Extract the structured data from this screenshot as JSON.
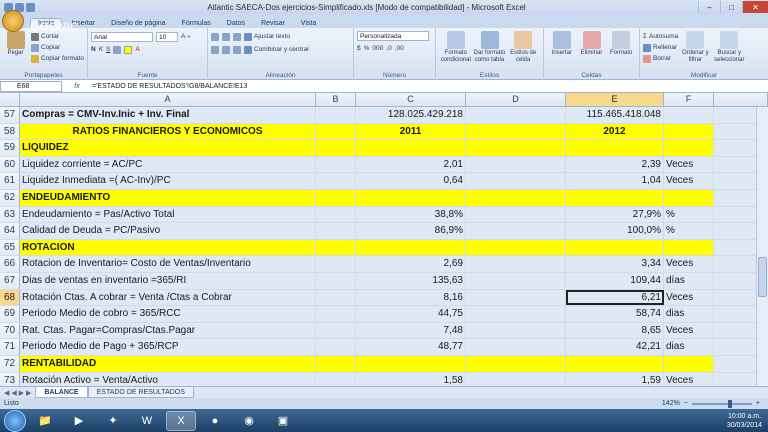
{
  "window": {
    "title": "Atlantic SAECA-Dos ejercicios-Simplificado.xls [Modo de compatibilidad] - Microsoft Excel",
    "watermark": "GOONIC"
  },
  "tabs": [
    "Inicio",
    "Insertar",
    "Diseño de página",
    "Fórmulas",
    "Datos",
    "Revisar",
    "Vista"
  ],
  "ribbon": {
    "paste": "Pegar",
    "cut": "Cortar",
    "copy": "Copiar",
    "format_painter": "Copiar formato",
    "clipboard": "Portapapeles",
    "font_name": "Arial",
    "font_size": "10",
    "font_group": "Fuente",
    "wrap_text": "Ajustar texto",
    "merge_center": "Combinar y centrar",
    "alignment": "Alineación",
    "number_format": "Personalizada",
    "number": "Número",
    "cond_format": "Formato condicional",
    "table_format": "Dar formato como tabla",
    "cell_styles": "Estilos de celda",
    "styles": "Estilos",
    "insert": "Insertar",
    "delete": "Eliminar",
    "format": "Formato",
    "cells": "Celdas",
    "autosum": "Autosuma",
    "fill": "Rellenar",
    "clear": "Borrar",
    "sort_filter": "Ordenar y filtrar",
    "find_select": "Buscar y seleccionar",
    "modify": "Modificar"
  },
  "formula_bar": {
    "name_box": "E68",
    "fx": "fx",
    "formula": "='ESTADO DE RESULTADOS'!G8/BALANCE!E13"
  },
  "columns": [
    "A",
    "B",
    "C",
    "D",
    "E",
    "F"
  ],
  "rows": [
    {
      "n": "57",
      "a": "Compras = CMV-Inv.Inic + Inv. Final",
      "c": "128.025.429.218",
      "e": "115.465.418.048",
      "f": ""
    },
    {
      "n": "58",
      "a": "RATIOS FINANCIEROS Y ECONOMICOS",
      "c": "2011",
      "e": "2012",
      "f": ""
    },
    {
      "n": "59",
      "a": "LIQUIDEZ",
      "c": "",
      "e": "",
      "f": ""
    },
    {
      "n": "60",
      "a": "Liquidez corriente = AC/PC",
      "c": "2,01",
      "e": "2,39",
      "f": "Veces"
    },
    {
      "n": "61",
      "a": "Liquidez Inmediata =( AC-Inv)/PC",
      "c": "0,64",
      "e": "1,04",
      "f": "Veces"
    },
    {
      "n": "62",
      "a": "ENDEUDAMIENTO",
      "c": "",
      "e": "",
      "f": ""
    },
    {
      "n": "63",
      "a": "Endeudamiento = Pas/Activo Total",
      "c": "38,8%",
      "e": "27,9%",
      "f": "%"
    },
    {
      "n": "64",
      "a": "Calidad de Deuda = PC/Pasivo",
      "c": "86,9%",
      "e": "100,0%",
      "f": "%"
    },
    {
      "n": "65",
      "a": "ROTACION",
      "c": "",
      "e": "",
      "f": ""
    },
    {
      "n": "66",
      "a": "Rotacion de Inventario= Costo de Ventas/Inventario",
      "c": "2,69",
      "e": "3,34",
      "f": "Veces"
    },
    {
      "n": "67",
      "a": "Dias de ventas en inventario =365/RI",
      "c": "135,63",
      "e": "109,44",
      "f": "días"
    },
    {
      "n": "68",
      "a": "Rotación Ctas. A cobrar = Venta /Ctas a Cobrar",
      "c": "8,16",
      "e": "6,21",
      "f": "Veces"
    },
    {
      "n": "69",
      "a": "Periodo Medio de cobro = 365/RCC",
      "c": "44,75",
      "e": "58,74",
      "f": "dias"
    },
    {
      "n": "70",
      "a": "Rat. Ctas. Pagar=Compras/Ctas.Pagar",
      "c": "7,48",
      "e": "8,65",
      "f": "Veces"
    },
    {
      "n": "71",
      "a": "Periodo Medio de   Pago + 365/RCP",
      "c": "48,77",
      "e": "42,21",
      "f": "dias"
    },
    {
      "n": "72",
      "a": "RENTABILIDAD",
      "c": "",
      "e": "",
      "f": ""
    },
    {
      "n": "73",
      "a": "Rotación Activo =  Venta/Activo",
      "c": "1,58",
      "e": "1,59",
      "f": "Veces"
    }
  ],
  "sheets": [
    "BALANCE",
    "ESTADO DE RESULTADOS"
  ],
  "status": {
    "ready": "Listo",
    "zoom": "142%"
  },
  "clock": {
    "time": "10:00 a.m.",
    "date": "30/03/2014"
  },
  "colors": {
    "section_yellow": "#ffff00",
    "selection_header": "#f8d88b"
  }
}
